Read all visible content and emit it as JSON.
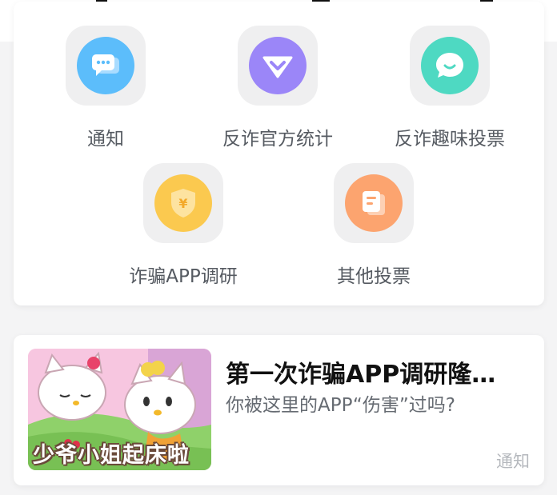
{
  "menu": {
    "items": [
      {
        "label": "通知",
        "icon": "message-icon",
        "color": "#5cbdfb"
      },
      {
        "label": "反诈官方统计",
        "icon": "shield-check-icon",
        "color": "#9b86f8"
      },
      {
        "label": "反诈趣味投票",
        "icon": "smile-bubble-icon",
        "color": "#4ed9c2"
      },
      {
        "label": "诈骗APP调研",
        "icon": "yuan-shield-icon",
        "color": "#fbc94f"
      },
      {
        "label": "其他投票",
        "icon": "note-icon",
        "color": "#fca46f"
      }
    ]
  },
  "article": {
    "title": "第一次诈骗APP调研隆…",
    "subtitle": "你被这里的APP“伤害”过吗?",
    "tag": "通知",
    "thumbnail_caption": "少爷小姐起床啦"
  }
}
